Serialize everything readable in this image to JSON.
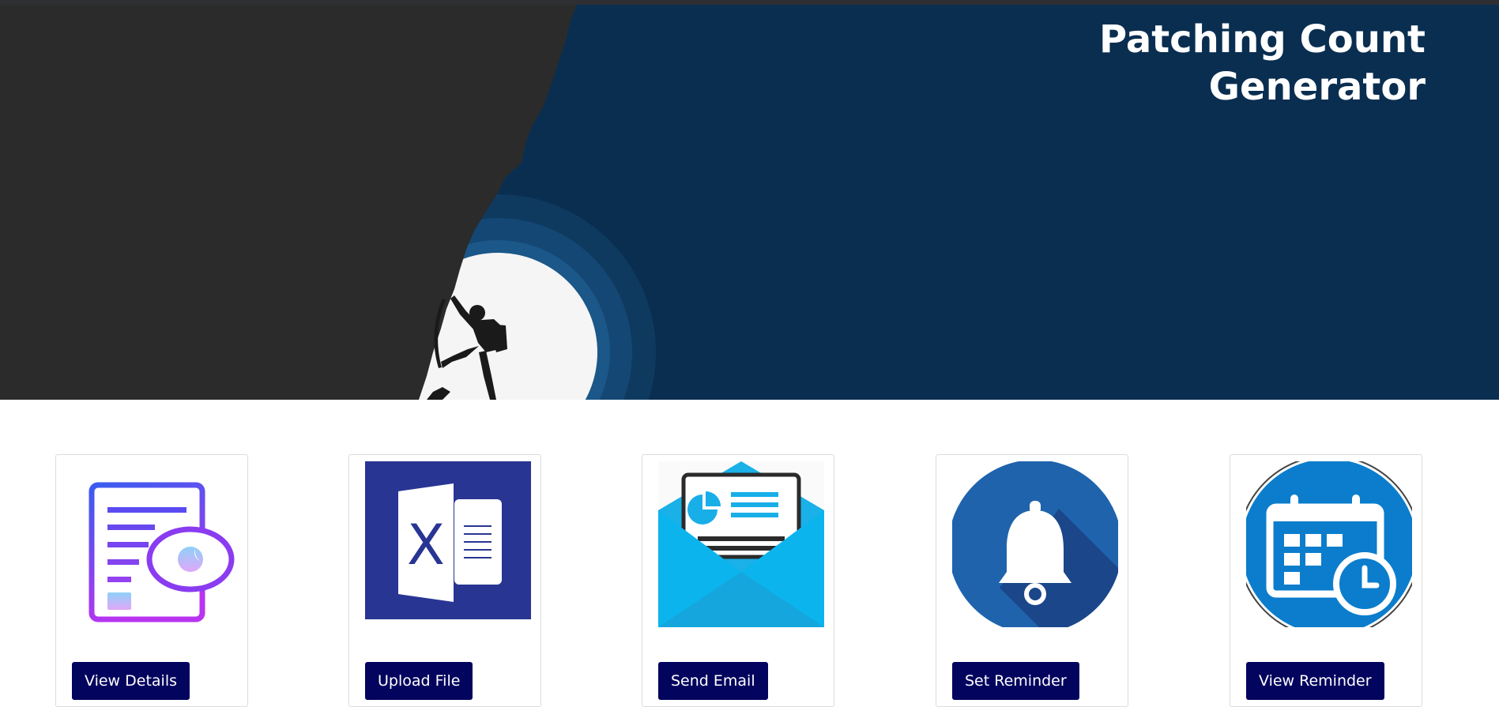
{
  "header": {
    "title_line1": "Patching Count",
    "title_line2": "Generator",
    "banner_image": "rock-climber-silhouette"
  },
  "colors": {
    "hero_background": "#0a2e50",
    "cliff": "#2b2b2b",
    "button_background": "#03045e",
    "button_text": "#ffffff"
  },
  "cards": [
    {
      "icon": "view-details-icon",
      "button_label": "View Details"
    },
    {
      "icon": "excel-file-icon",
      "button_label": "Upload File"
    },
    {
      "icon": "email-envelope-icon",
      "button_label": "Send Email"
    },
    {
      "icon": "bell-icon",
      "button_label": "Set Reminder"
    },
    {
      "icon": "calendar-clock-icon",
      "button_label": "View Reminder"
    }
  ]
}
